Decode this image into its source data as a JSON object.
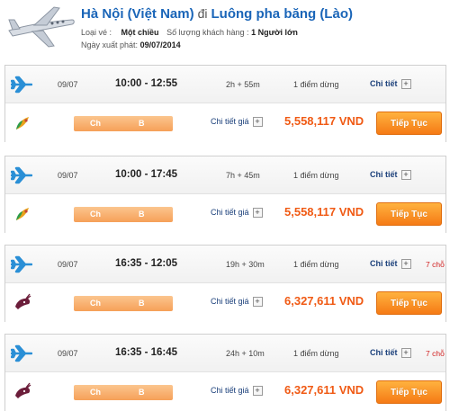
{
  "header": {
    "origin": "Hà Nội (Việt Nam)",
    "connector": "đi",
    "destination": "Luông pha băng (Lào)",
    "trip_type_label": "Loại vé :",
    "trip_type_value": "Một chiều",
    "passengers_label": "Số lượng khách hàng :",
    "passengers_value": "1 Người lớn",
    "departure_label": "Ngày xuất phát:",
    "departure_value": "09/07/2014"
  },
  "colors": {
    "accent_blue": "#1a65b8",
    "price_orange": "#f05a14",
    "button_orange": "#f57a15",
    "seat_red": "#d02020"
  },
  "labels": {
    "detail": "Chi tiết",
    "price_detail": "Chi tiết giá",
    "continue": "Tiếp Tục",
    "plus": "+",
    "class_a": "Ch",
    "class_b": "B"
  },
  "flights": [
    {
      "date": "09/07",
      "time": "10:00 - 12:55",
      "duration": "2h + 55m",
      "stops": "1 điểm dừng",
      "seats": "",
      "price": "5,558,117 VND",
      "airline_icon": "vietnam-airlines-lotus-icon"
    },
    {
      "date": "09/07",
      "time": "10:00 - 17:45",
      "duration": "7h + 45m",
      "stops": "1 điểm dừng",
      "seats": "",
      "price": "5,558,117 VND",
      "airline_icon": "vietnam-airlines-lotus-icon"
    },
    {
      "date": "09/07",
      "time": "16:35 - 12:05",
      "duration": "19h + 30m",
      "stops": "1 điểm dừng",
      "seats": "7 chỗ",
      "price": "6,327,611 VND",
      "airline_icon": "qatar-oryx-icon"
    },
    {
      "date": "09/07",
      "time": "16:35 - 16:45",
      "duration": "24h + 10m",
      "stops": "1 điểm dừng",
      "seats": "7 chỗ",
      "price": "6,327,611 VND",
      "airline_icon": "qatar-oryx-icon"
    }
  ]
}
